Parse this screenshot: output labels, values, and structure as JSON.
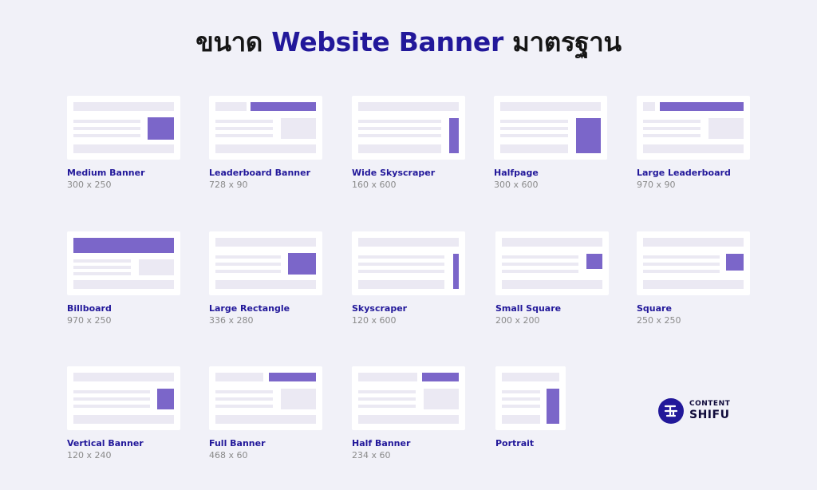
{
  "title": {
    "before": "ขนาด ",
    "highlight": "Website Banner",
    "after": " มาตรฐาน"
  },
  "colors": {
    "accent": "#22189a",
    "banner": "#7b66c9",
    "placeholder": "#ebe9f3"
  },
  "banners": [
    {
      "name": "Medium Banner",
      "size": "300 x 250"
    },
    {
      "name": "Leaderboard Banner",
      "size": "728 x 90"
    },
    {
      "name": "Wide Skyscraper",
      "size": "160 x 600"
    },
    {
      "name": "Halfpage",
      "size": "300 x 600"
    },
    {
      "name": "Large Leaderboard",
      "size": "970 x 90"
    },
    {
      "name": "Billboard",
      "size": "970 x 250"
    },
    {
      "name": "Large Rectangle",
      "size": "336 x 280"
    },
    {
      "name": "Skyscraper",
      "size": "120 x 600"
    },
    {
      "name": "Small Square",
      "size": "200 x 200"
    },
    {
      "name": "Square",
      "size": "250 x 250"
    },
    {
      "name": "Vertical Banner",
      "size": "120 x 240"
    },
    {
      "name": "Full Banner",
      "size": "468 x 60"
    },
    {
      "name": "Half Banner",
      "size": "234 x 60"
    },
    {
      "name": "Portrait",
      "size": ""
    }
  ],
  "logo": {
    "line1": "CONTENT",
    "line2": "SHIFU",
    "icon": "content-shifu-logo-icon"
  }
}
